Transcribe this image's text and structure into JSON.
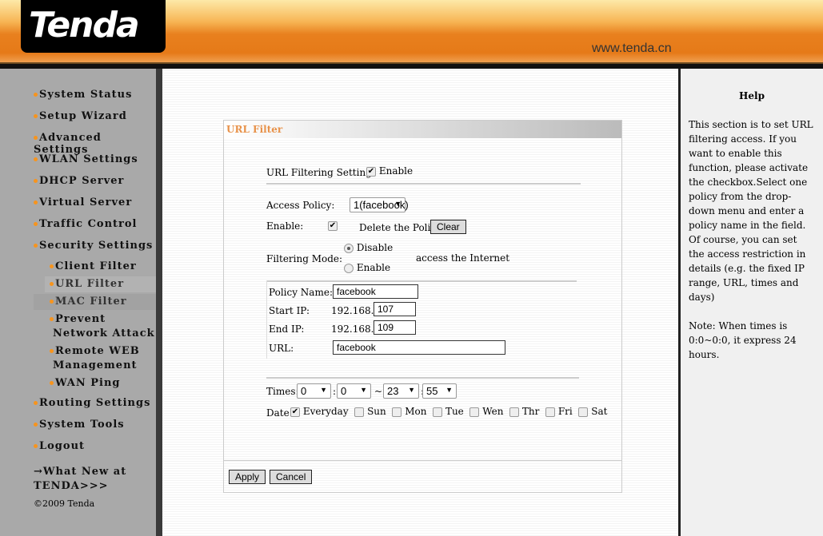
{
  "header": {
    "logo": "Tenda",
    "site": "www.tenda.cn"
  },
  "nav": [
    "System Status",
    "Setup Wizard",
    "Advanced Settings",
    "WLAN Settings",
    "DHCP Server",
    "Virtual Server",
    "Traffic Control",
    "Security Settings"
  ],
  "subnav": [
    "Client Filter",
    "URL Filter",
    "MAC Filter",
    "Prevent",
    "Network Attack",
    "Remote WEB",
    "Management",
    "WAN Ping"
  ],
  "nav2": [
    "Routing Settings",
    "System Tools",
    "Logout"
  ],
  "whatsnew": [
    "→What New at",
    "TENDA>>>"
  ],
  "copyright": "©2009 Tenda",
  "panel": {
    "title": "URL Filter",
    "url_filtering_label": "URL Filtering Setting:",
    "enable": "Enable",
    "access_policy_label": "Access Policy:",
    "access_policy": "1(facebook)",
    "enable_label": "Enable:",
    "delete_label": "Delete the Policy:",
    "clear": "Clear",
    "mode_label": "Filtering Mode:",
    "disable": "Disable",
    "mode_enable": "Enable",
    "mode_suffix": "access the Internet",
    "policy_name_label": "Policy Name:",
    "policy_name": "facebook",
    "start_ip_label": "Start IP:",
    "ip_prefix": "192.168.0.",
    "start_ip": "107",
    "end_ip_label": "End IP:",
    "end_ip": "109",
    "url_label": "URL:",
    "url": "facebook",
    "times_label": "Times:",
    "t1": "0",
    "t2": "0",
    "tilde": "~",
    "t3": "23",
    "t4": "55",
    "colon": ":",
    "date_label": "Date:",
    "days": [
      "Everyday",
      "Sun",
      "Mon",
      "Tue",
      "Wen",
      "Thr",
      "Fri",
      "Sat"
    ],
    "apply": "Apply",
    "cancel": "Cancel"
  },
  "help": {
    "title": "Help",
    "text": "This section is to set URL filtering access. If you want to enable this function, please activate the checkbox.Select one policy from the drop-down menu and enter a policy name in the field. Of course, you can set the access restriction in details (e.g. the fixed IP range, URL, times and days)",
    "note": "Note: When times is 0:0~0:0, it express 24 hours."
  }
}
